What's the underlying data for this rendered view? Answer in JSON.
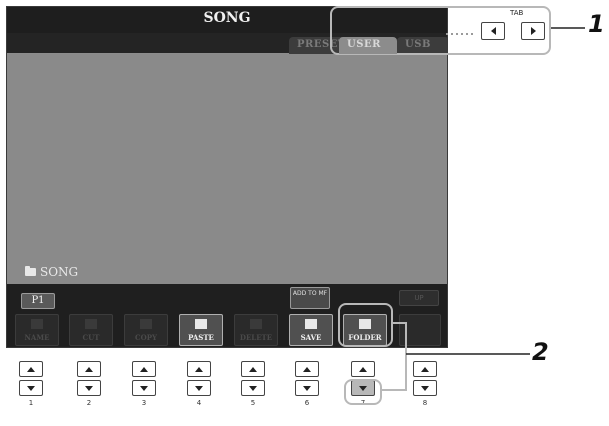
{
  "screen": {
    "title": "SONG",
    "tabs": [
      {
        "label": "PRESET",
        "selected": false
      },
      {
        "label": "USER",
        "selected": true
      },
      {
        "label": "USB",
        "selected": false
      }
    ],
    "current_path": "SONG",
    "page_button": "P1",
    "add_to_label": "ADD TO MF",
    "up_label": "UP",
    "function_buttons": [
      {
        "label": "NAME",
        "enabled": false
      },
      {
        "label": "CUT",
        "enabled": false
      },
      {
        "label": "COPY",
        "enabled": false
      },
      {
        "label": "PASTE",
        "enabled": true
      },
      {
        "label": "DELETE",
        "enabled": false
      },
      {
        "label": "SAVE",
        "enabled": true
      },
      {
        "label": "FOLDER",
        "enabled": true
      }
    ]
  },
  "hardware": {
    "tab_label": "TAB",
    "button_numbers": [
      "1",
      "2",
      "3",
      "4",
      "5",
      "6",
      "7",
      "8"
    ]
  },
  "callouts": [
    "1",
    "2"
  ],
  "colors": {
    "screen_bg": "#8c8c8c",
    "title_bar": "#1e1e1e",
    "callout_outline": "#b8b8b8"
  }
}
